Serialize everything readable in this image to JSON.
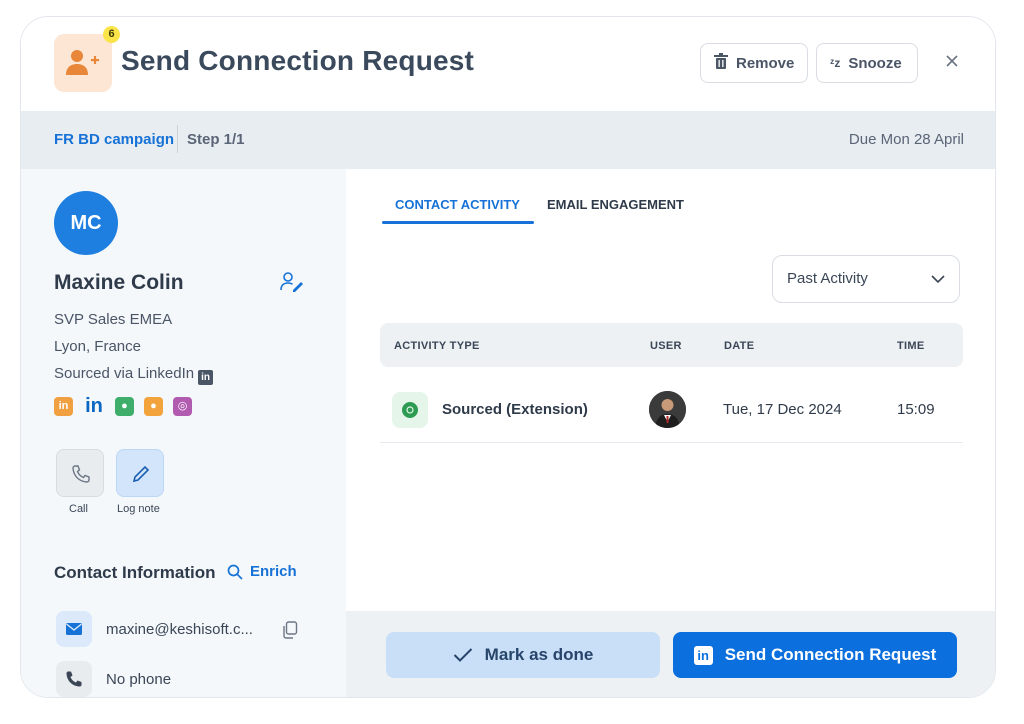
{
  "header": {
    "title": "Send Connection Request",
    "task_count": "6",
    "remove_label": "Remove",
    "snooze_label": "Snooze"
  },
  "campaign": {
    "name": "FR BD campaign",
    "step": "Step 1/1",
    "due": "Due Mon 28 April"
  },
  "contact": {
    "initials": "MC",
    "name": "Maxine Colin",
    "title": "SVP Sales EMEA",
    "location": "Lyon, France",
    "source": "Sourced via LinkedIn",
    "actions": {
      "call_label": "Call",
      "note_label": "Log note"
    },
    "info_title": "Contact Information",
    "enrich_label": "Enrich",
    "email": "maxine@keshisoft.c...",
    "phone": "No phone"
  },
  "tabs": [
    "CONTACT ACTIVITY",
    "EMAIL ENGAGEMENT"
  ],
  "filter": {
    "selected": "Past Activity"
  },
  "table": {
    "columns": [
      "ACTIVITY TYPE",
      "USER",
      "DATE",
      "TIME"
    ],
    "rows": [
      {
        "type": "Sourced (Extension)",
        "date": "Tue, 17 Dec 2024",
        "time": "15:09"
      }
    ]
  },
  "footer": {
    "done_label": "Mark as done",
    "send_label": "Send Connection Request"
  },
  "colors": {
    "accent": "#1672d6",
    "primary_button": "#0b6fde",
    "task_icon_bg": "#fde7d4",
    "badge": "#fbe44a"
  }
}
